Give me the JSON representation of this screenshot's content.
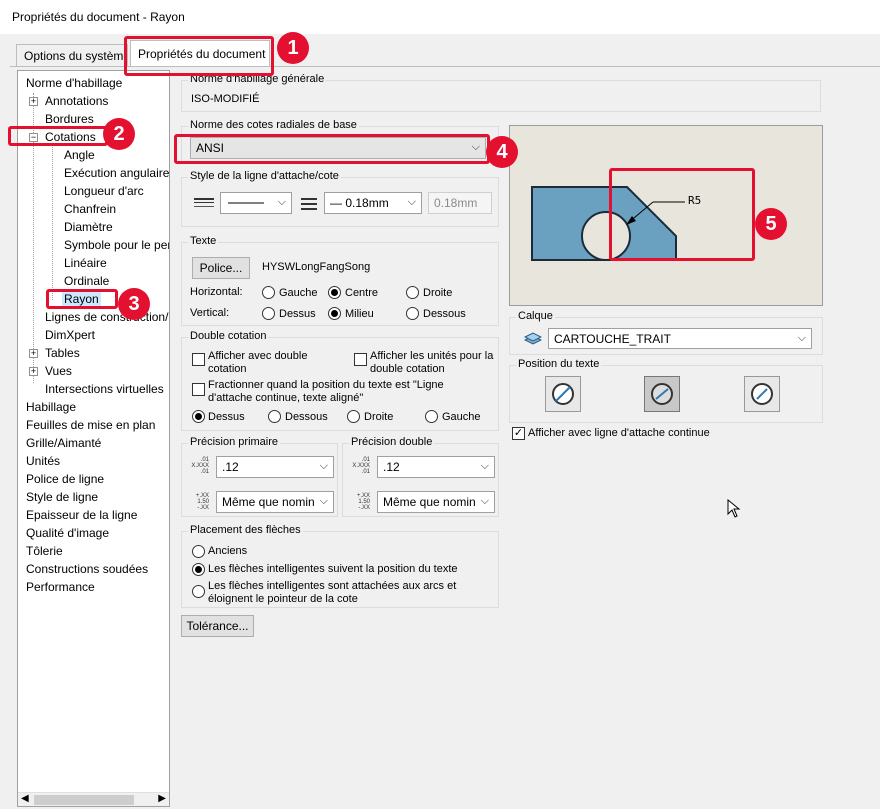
{
  "window": {
    "title": "Propriétés du document - Rayon"
  },
  "tabs": [
    {
      "label": "Options du système"
    },
    {
      "label": "Propriétés du document"
    }
  ],
  "tree": {
    "items": [
      "Norme d'habillage",
      "Annotations",
      "Bordures",
      "Cotations",
      "Angle",
      "Exécution angulaire",
      "Longueur d'arc",
      "Chanfrein",
      "Diamètre",
      "Symbole pour le per",
      "Linéaire",
      "Ordinale",
      "Rayon",
      "Lignes de construction/",
      "DimXpert",
      "Tables",
      "Vues",
      "Intersections virtuelles",
      "Habillage",
      "Feuilles de mise en plan",
      "Grille/Aimanté",
      "Unités",
      "Police de ligne",
      "Style de ligne",
      "Epaisseur de la ligne",
      "Qualité d'image",
      "Tôlerie",
      "Constructions soudées",
      "Performance"
    ]
  },
  "overall_standard": {
    "label": "Norme d'habillage générale",
    "value": "ISO-MODIFIÉ"
  },
  "radial_standard": {
    "label": "Norme des cotes radiales de base",
    "value": "ANSI"
  },
  "leader_style": {
    "label": "Style de la ligne d'attache/cote",
    "thickness": "0.18mm",
    "custom": "0.18mm"
  },
  "text": {
    "label": "Texte",
    "font_button": "Police...",
    "font_name": "HYSWLongFangSong",
    "horizontal_label": "Horizontal:",
    "vertical_label": "Vertical:",
    "h_options": [
      "Gauche",
      "Centre",
      "Droite"
    ],
    "v_options": [
      "Dessus",
      "Milieu",
      "Dessous"
    ]
  },
  "dual": {
    "label": "Double cotation",
    "show_dual": "Afficher avec double cotation",
    "show_units": "Afficher les unités pour la double cotation",
    "split": "Fractionner quand la position du texte est \"Ligne d'attache continue, texte aligné\"",
    "options": [
      "Dessus",
      "Dessous",
      "Droite",
      "Gauche"
    ]
  },
  "primary_precision": {
    "label": "Précision primaire",
    "value": ".12",
    "tolerance": "Même que nomin",
    "icon1": [
      "X.XXX",
      ".01",
      ".01"
    ],
    "icon2": [
      "1.50",
      "+.XX",
      "-.XX"
    ]
  },
  "dual_precision": {
    "label": "Précision double",
    "value": ".12",
    "tolerance": "Même que nomin",
    "icon1": [
      "X.XXX",
      ".01",
      ".01"
    ],
    "icon2": [
      "1.50",
      "+.XX",
      "-.XX"
    ]
  },
  "arrows": {
    "label": "Placement des flèches",
    "options": [
      "Anciens",
      "Les flèches intelligentes suivent la position du texte",
      "Les flèches intelligentes sont attachées aux arcs et éloignent le pointeur de la cote"
    ]
  },
  "tolerance_button": "Tolérance...",
  "preview": {
    "label": "R5"
  },
  "layer": {
    "label": "Calque",
    "value": "CARTOUCHE_TRAIT"
  },
  "text_position": {
    "label": "Position du texte"
  },
  "continuous_leader": "Afficher avec ligne d'attache continue",
  "callouts": [
    "1",
    "2",
    "3",
    "4",
    "5"
  ],
  "colors": {
    "callout": "#e4102f",
    "preview_part": "#6aa0c0",
    "selection": "#cce8ff"
  }
}
